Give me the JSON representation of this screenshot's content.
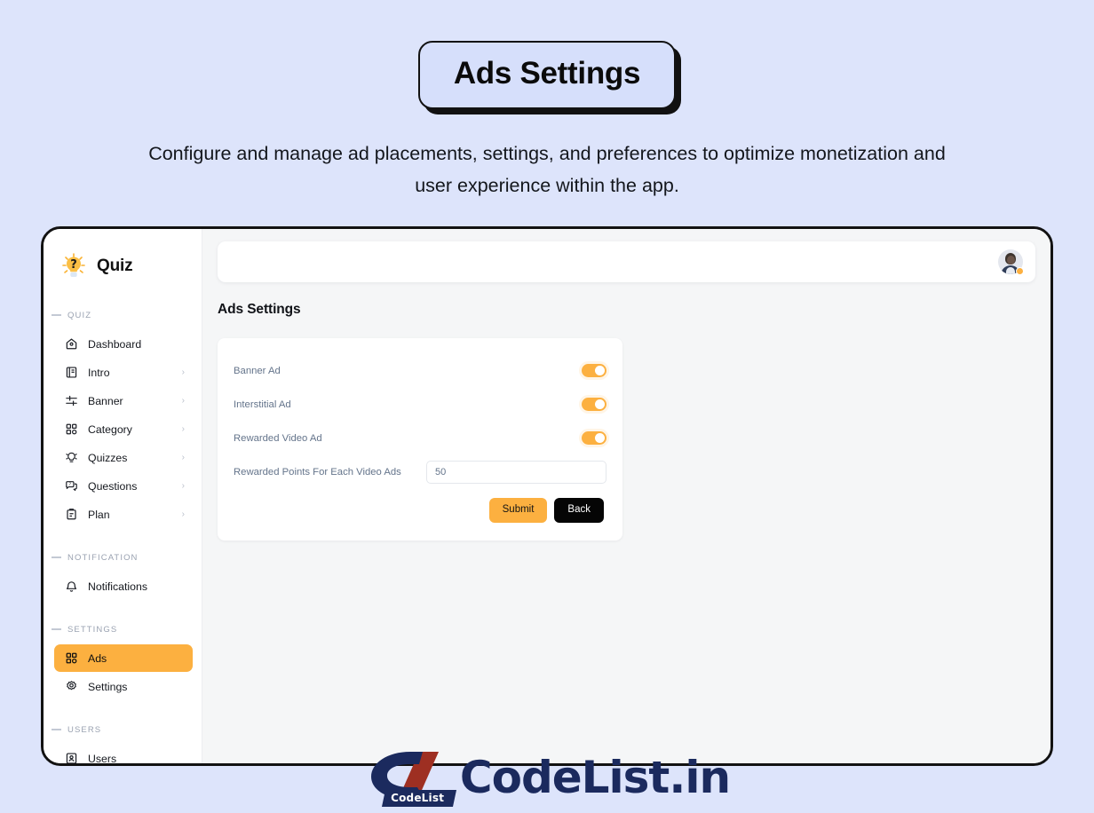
{
  "hero": {
    "title": "Ads Settings",
    "subtitle": "Configure and manage ad placements, settings, and preferences to optimize monetization and user experience within the app."
  },
  "sidebar": {
    "brand": {
      "name": "Quiz",
      "logo_icon": "lightbulb-question-icon"
    },
    "sections": [
      {
        "label": "QUIZ",
        "items": [
          {
            "label": "Dashboard",
            "icon": "home-icon",
            "chevron": "",
            "active": false
          },
          {
            "label": "Intro",
            "icon": "book-icon",
            "chevron": "›",
            "active": false
          },
          {
            "label": "Banner",
            "icon": "sliders-icon",
            "chevron": "›",
            "active": false
          },
          {
            "label": "Category",
            "icon": "grid-icon",
            "chevron": "›",
            "active": false
          },
          {
            "label": "Quizzes",
            "icon": "lightbulb-icon",
            "chevron": "›",
            "active": false
          },
          {
            "label": "Questions",
            "icon": "chat-question-icon",
            "chevron": "›",
            "active": false
          },
          {
            "label": "Plan",
            "icon": "clipboard-icon",
            "chevron": "›",
            "active": false
          }
        ]
      },
      {
        "label": "NOTIFICATION",
        "items": [
          {
            "label": "Notifications",
            "icon": "bell-icon",
            "chevron": "",
            "active": false
          }
        ]
      },
      {
        "label": "SETTINGS",
        "items": [
          {
            "label": "Ads",
            "icon": "grid-icon",
            "chevron": "",
            "active": true
          },
          {
            "label": "Settings",
            "icon": "gear-icon",
            "chevron": "",
            "active": false
          }
        ]
      },
      {
        "label": "USERS",
        "items": [
          {
            "label": "Users",
            "icon": "user-badge-icon",
            "chevron": "",
            "active": false
          }
        ]
      }
    ]
  },
  "topbar": {
    "avatar_icon": "user-avatar",
    "status": "online"
  },
  "main": {
    "page_title": "Ads Settings",
    "toggles": [
      {
        "label": "Banner Ad",
        "on": true
      },
      {
        "label": "Interstitial Ad",
        "on": true
      },
      {
        "label": "Rewarded Video Ad",
        "on": true
      }
    ],
    "field": {
      "label": "Rewarded Points For Each Video Ads",
      "value": "50",
      "placeholder": "50"
    },
    "buttons": {
      "submit": "Submit",
      "back": "Back"
    }
  },
  "watermark": {
    "text": "CodeList.in",
    "badge": "CodeList"
  },
  "colors": {
    "page_background": "#dde4fb",
    "accent": "#fcb040",
    "dark": "#050505",
    "main_background": "#f5f6f7",
    "label_text": "#64748b",
    "watermark_navy": "#1b2a5e",
    "watermark_red": "#9e2f22"
  }
}
